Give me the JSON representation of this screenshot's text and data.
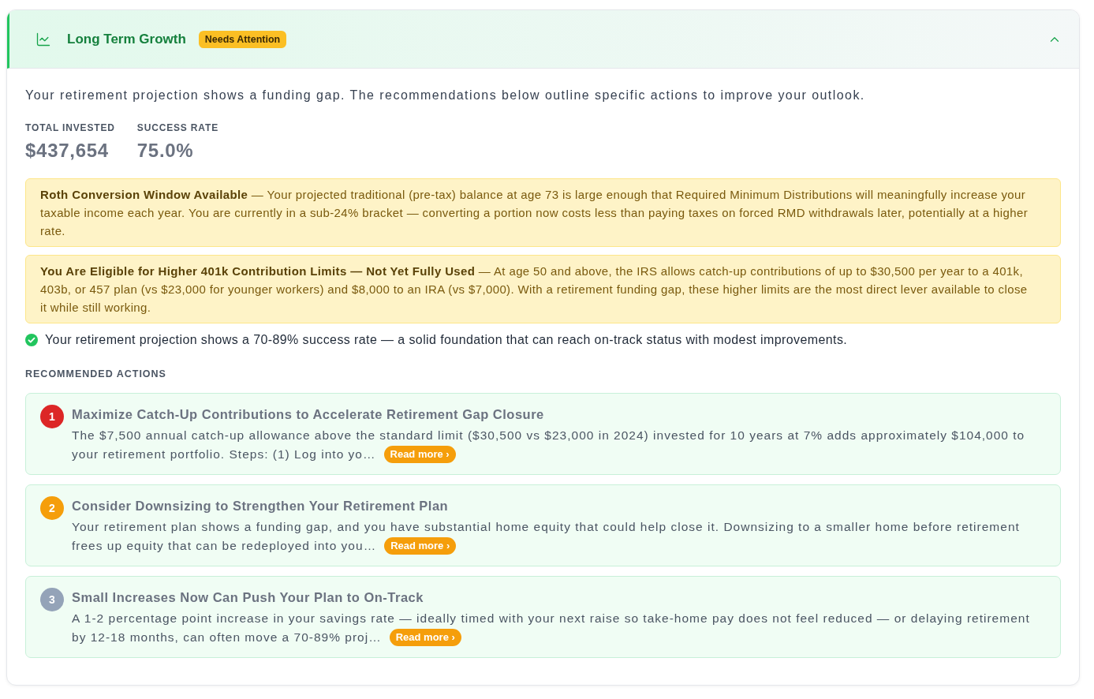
{
  "section": {
    "title": "Long Term Growth",
    "badge": "Needs Attention",
    "expanded": true
  },
  "summary": "Your retirement projection shows a funding gap. The recommendations below outline specific actions to improve your outlook.",
  "stats": [
    {
      "label": "TOTAL INVESTED",
      "value": "$437,654"
    },
    {
      "label": "SUCCESS RATE",
      "value": "75.0%"
    }
  ],
  "alerts": [
    {
      "text": "**Roth Conversion Window Available** — Your projected traditional (pre-tax) balance at age 73 is large enough that Required Minimum Distributions will meaningfully increase your taxable income each year. You are currently in a sub-24% bracket — converting a portion now costs less than paying taxes on forced RMD withdrawals later, potentially at a higher rate."
    },
    {
      "text": "**You Are Eligible for Higher 401k Contribution Limits — Not Yet Fully Used** — At age 50 and above, the IRS allows catch-up contributions of up to $30,500 per year to a 401k, 403b, or 457 plan (vs $23,000 for younger workers) and $8,000 to an IRA (vs $7,000). With a retirement funding gap, these higher limits are the most direct lever available to close it while still working."
    }
  ],
  "status_note": "Your retirement projection shows a 70-89% success rate — a solid foundation that can reach on-track status with modest improvements.",
  "actions_heading": "RECOMMENDED ACTIONS",
  "actions": [
    {
      "number": "1",
      "color": "#dc2626",
      "title": "Maximize Catch-Up Contributions to Accelerate Retirement Gap Closure",
      "text_lines": [
        "The $7,500 annual catch-up allowance above the standard limit ($30,500 vs $23,000 in 2024) invested for 10 years at 7% adds approximately $104,000 to",
        "your retirement portfolio. Steps: (1) Log into yo…"
      ],
      "button": "Read more ›"
    },
    {
      "number": "2",
      "color": "#f59e0b",
      "title": "Consider Downsizing to Strengthen Your Retirement Plan",
      "text_lines": [
        "Your retirement plan shows a funding gap, and you have substantial home equity that could help close it. Downsizing to a smaller home before retirement",
        "frees up equity that can be redeployed into you…"
      ],
      "button": "Read more ›"
    },
    {
      "number": "3",
      "color": "#94a3b8",
      "title": "Small Increases Now Can Push Your Plan to On-Track",
      "text_lines": [
        "A 1-2 percentage point increase in your savings rate — ideally timed with your next raise so take-home pay does not feel reduced — or delaying retirement",
        "by 12-18 months, can often move a 70-89% proj…"
      ],
      "button": "Read more ›"
    }
  ]
}
